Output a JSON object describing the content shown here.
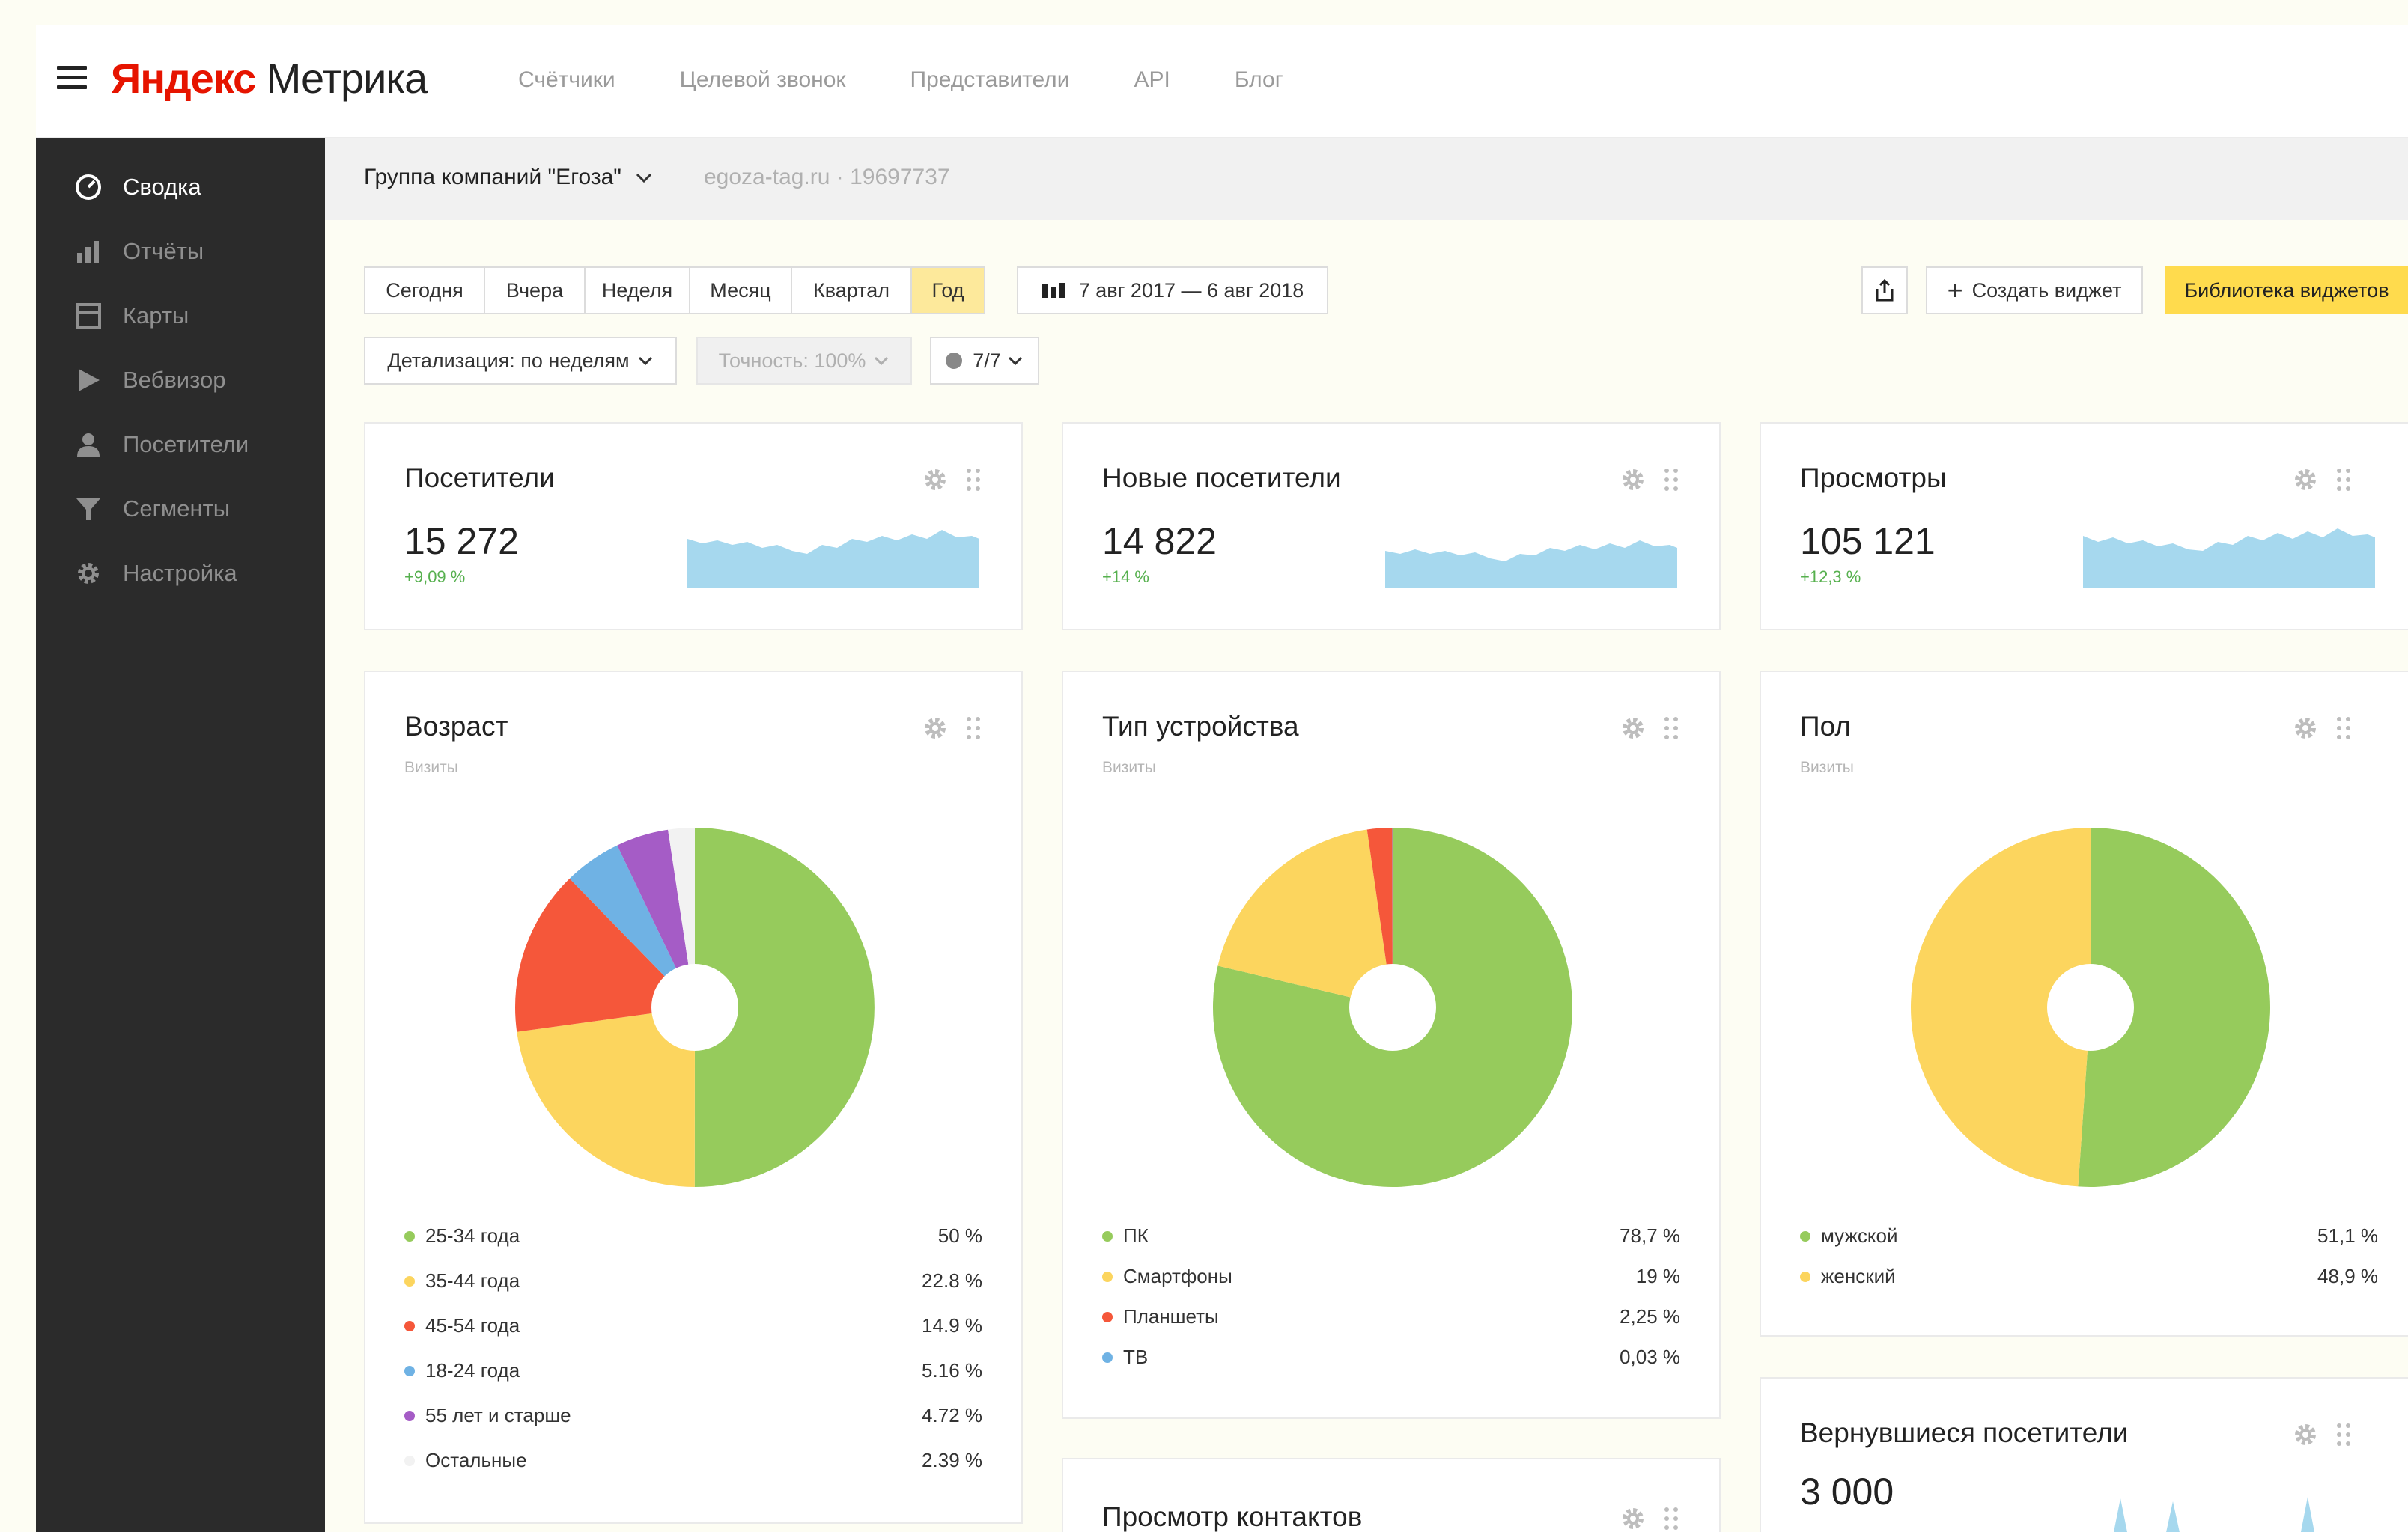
{
  "app": {
    "logo_brand": "Яндекс",
    "logo_product": "Метрика"
  },
  "topnav": [
    "Счётчики",
    "Целевой звонок",
    "Представители",
    "API",
    "Блог"
  ],
  "sidebar": {
    "items": [
      {
        "label": "Сводка",
        "icon": "dashboard-icon",
        "active": true
      },
      {
        "label": "Отчёты",
        "icon": "bar-chart-icon"
      },
      {
        "label": "Карты",
        "icon": "map-icon"
      },
      {
        "label": "Вебвизор",
        "icon": "play-icon"
      },
      {
        "label": "Посетители",
        "icon": "person-icon"
      },
      {
        "label": "Сегменты",
        "icon": "filter-icon"
      },
      {
        "label": "Настройка",
        "icon": "gear-icon"
      }
    ]
  },
  "crumbs": {
    "org": "Группа компаний \"Егоза\"",
    "site": "egoza-tag.ru · 19697737"
  },
  "periods": [
    "Сегодня",
    "Вчера",
    "Неделя",
    "Месяц",
    "Квартал",
    "Год"
  ],
  "selected_period": "Год",
  "date_range": "7 авг 2017 — 6 авг 2018",
  "detail": "Детализация: по неделям",
  "accuracy": "Точность: 100%",
  "segments": "7/7",
  "actions": {
    "create_widget": "Создать виджет",
    "library": "Библиотека виджетов"
  },
  "metrics": [
    {
      "title": "Посетители",
      "value": "15 272",
      "delta": "+9,09 %"
    },
    {
      "title": "Новые посетители",
      "value": "14 822",
      "delta": "+14 %"
    },
    {
      "title": "Просмотры",
      "value": "105 121",
      "delta": "+12,3 %"
    }
  ],
  "pies": [
    {
      "title": "Возраст",
      "subtitle": "Визиты",
      "chart_data": {
        "type": "pie",
        "labels": [
          "25-34 года",
          "35-44 года",
          "45-54 года",
          "18-24 года",
          "55 лет и старше",
          "Остальные"
        ],
        "values": [
          50,
          22.8,
          14.9,
          5.16,
          4.72,
          2.39
        ],
        "value_labels": [
          "50 %",
          "22.8 %",
          "14.9 %",
          "5.16 %",
          "4.72 %",
          "2.39 %"
        ],
        "colors": [
          "#96cb5c",
          "#fcd55e",
          "#f5573a",
          "#6fb2e4",
          "#a55cc6",
          "#f2f2f2"
        ]
      }
    },
    {
      "title": "Тип устройства",
      "subtitle": "Визиты",
      "chart_data": {
        "type": "pie",
        "labels": [
          "ПК",
          "Смартфоны",
          "Планшеты",
          "ТВ"
        ],
        "values": [
          78.7,
          19,
          2.25,
          0.03
        ],
        "value_labels": [
          "78,7 %",
          "19 %",
          "2,25 %",
          "0,03 %"
        ],
        "colors": [
          "#96cb5c",
          "#fcd55e",
          "#f5573a",
          "#6fb2e4"
        ]
      }
    },
    {
      "title": "Пол",
      "subtitle": "Визиты",
      "chart_data": {
        "type": "pie",
        "labels": [
          "мужской",
          "женский"
        ],
        "values": [
          51.1,
          48.9
        ],
        "value_labels": [
          "51,1 %",
          "48,9 %"
        ],
        "colors": [
          "#96cb5c",
          "#fcd55e"
        ]
      }
    }
  ],
  "bottom_cards": {
    "contacts": "Просмотр контактов",
    "returning_title": "Вернувшиеся посетители",
    "returning_value": "3 000"
  }
}
